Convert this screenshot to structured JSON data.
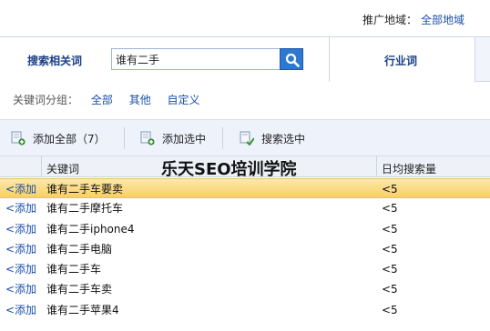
{
  "region": {
    "label": "推广地域：",
    "value": "全部地域"
  },
  "tabs": {
    "search_label": "搜索相关词",
    "industry_label": "行业词"
  },
  "search": {
    "value": "谁有二手",
    "icon": "search-icon"
  },
  "groups": {
    "label": "关键词分组：",
    "items": [
      "全部",
      "其他",
      "自定义"
    ]
  },
  "toolbar": {
    "add_all": "添加全部（7）",
    "add_selected": "添加选中",
    "search_selected": "搜索选中"
  },
  "table": {
    "columns": [
      "关键词",
      "日均搜索量"
    ],
    "add_label": "<添加",
    "rows": [
      {
        "keyword": "谁有二手车要卖",
        "volume": "<5",
        "selected": true
      },
      {
        "keyword": "谁有二手摩托车",
        "volume": "<5"
      },
      {
        "keyword": "谁有二手iphone4",
        "volume": "<5"
      },
      {
        "keyword": "谁有二手电脑",
        "volume": "<5"
      },
      {
        "keyword": "谁有二手车",
        "volume": "<5"
      },
      {
        "keyword": "谁有二手车卖",
        "volume": "<5"
      },
      {
        "keyword": "谁有二手苹果4",
        "volume": "<5"
      }
    ]
  },
  "watermark": "乐天SEO培训学院",
  "colors": {
    "link": "#1a4fa8",
    "selected_row": "#f8cf68",
    "search_button": "#2f78d0"
  }
}
